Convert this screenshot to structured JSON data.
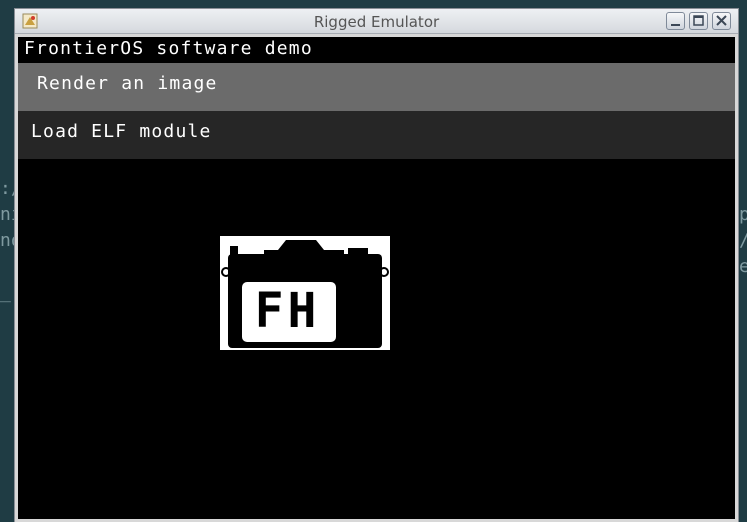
{
  "window": {
    "title": "Rigged Emulator",
    "buttons": [
      "minimize",
      "maximize",
      "close"
    ]
  },
  "screen": {
    "title": "FrontierOS software demo",
    "menu": [
      {
        "label": "Render an image",
        "selected": true
      },
      {
        "label": "Load ELF module",
        "selected": false
      }
    ],
    "image": {
      "logo_text": "FH",
      "icon": "camera-logo"
    }
  },
  "colors": {
    "desktop": "#1f3c44",
    "screen_bg": "#000000",
    "selected_item": "#6b6b6b",
    "unselected_item": "#262626",
    "text": "#ffffff"
  }
}
